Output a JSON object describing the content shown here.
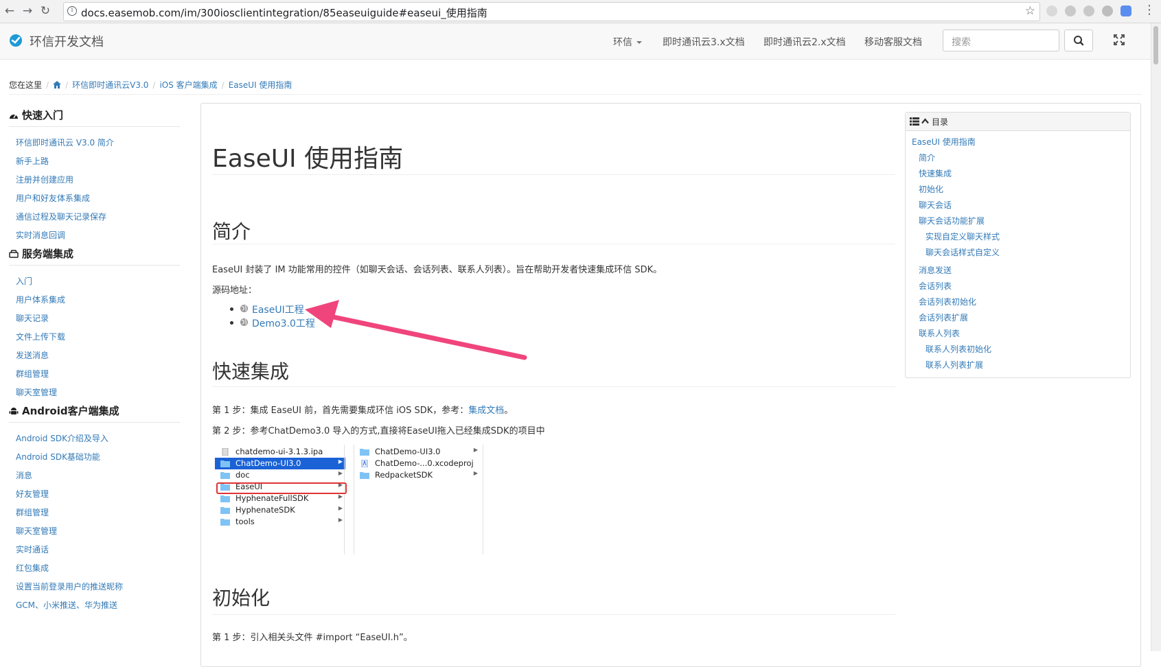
{
  "browser": {
    "url": "docs.easemob.com/im/300iosclientintegration/85easeuiguide#easeui_使用指南"
  },
  "header": {
    "brand": "环信开发文档",
    "nav": [
      "环信",
      "即时通讯云3.x文档",
      "即时通讯云2.x文档",
      "移动客服文档"
    ],
    "search_placeholder": "搜索"
  },
  "breadcrumb": {
    "prefix": "您在这里",
    "items": [
      "环信即时通讯云V3.0",
      "iOS 客户端集成",
      "EaseUI 使用指南"
    ]
  },
  "sidebar": {
    "sections": [
      {
        "title": "快速入门",
        "links": [
          "环信即时通讯云 V3.0 简介",
          "新手上路",
          "注册并创建应用",
          "用户和好友体系集成",
          "通信过程及聊天记录保存",
          "实时消息回调"
        ]
      },
      {
        "title": "服务端集成",
        "links": [
          "入门",
          "用户体系集成",
          "聊天记录",
          "文件上传下载",
          "发送消息",
          "群组管理",
          "聊天室管理"
        ]
      },
      {
        "title": "Android客户端集成",
        "links": [
          "Android SDK介绍及导入",
          "Android SDK基础功能",
          "消息",
          "好友管理",
          "群组管理",
          "聊天室管理",
          "实时通话",
          "红包集成",
          "设置当前登录用户的推送昵称",
          "GCM、小米推送、华为推送"
        ]
      }
    ]
  },
  "main": {
    "title": "EaseUI 使用指南",
    "intro_heading": "简介",
    "intro_text": "EaseUI 封装了 IM 功能常用的控件（如聊天会话、会话列表、联系人列表）。旨在帮助开发者快速集成环信 SDK。",
    "source_label": "源码地址：",
    "source_links": [
      "EaseUI工程",
      "Demo3.0工程"
    ],
    "quick_heading": "快速集成",
    "step1_prefix": "第 1 步：集成 EaseUI 前，首先需要集成环信 iOS SDK，参考：",
    "step1_link": "集成文档",
    "step1_suffix": "。",
    "step2": "第 2 步：参考ChatDemo3.0 导入的方式,直接将EaseUI拖入已经集成SDK的项目中",
    "init_heading": "初始化",
    "init_step1": "第 1 步：引入相关头文件 #import “EaseUI.h”。"
  },
  "finder": {
    "col1": [
      "chatdemo-ui-3.1.3.ipa",
      "ChatDemo-UI3.0",
      "doc",
      "EaseUI",
      "HyphenateFullSDK",
      "HyphenateSDK",
      "tools"
    ],
    "col2": [
      "ChatDemo-UI3.0",
      "ChatDemo-...0.xcodeproj",
      "RedpacketSDK"
    ]
  },
  "toc": {
    "title": "目录",
    "items": [
      {
        "label": "EaseUI 使用指南",
        "level": 0
      },
      {
        "label": "简介",
        "level": 1
      },
      {
        "label": "快速集成",
        "level": 1
      },
      {
        "label": "初始化",
        "level": 1
      },
      {
        "label": "聊天会话",
        "level": 1
      },
      {
        "label": "聊天会话功能扩展",
        "level": 1
      },
      {
        "label": "实现自定义聊天样式",
        "level": 2
      },
      {
        "label": "聊天会话样式自定义",
        "level": 2
      },
      {
        "label": "消息发送",
        "level": 1
      },
      {
        "label": "会话列表",
        "level": 1
      },
      {
        "label": "会话列表初始化",
        "level": 1
      },
      {
        "label": "会话列表扩展",
        "level": 1
      },
      {
        "label": "联系人列表",
        "level": 1
      },
      {
        "label": "联系人列表初始化",
        "level": 2
      },
      {
        "label": "联系人列表扩展",
        "level": 2
      }
    ]
  },
  "colors": {
    "link": "#337ab7",
    "annotation_arrow": "#f0457c",
    "selection": "#1a62d6"
  }
}
